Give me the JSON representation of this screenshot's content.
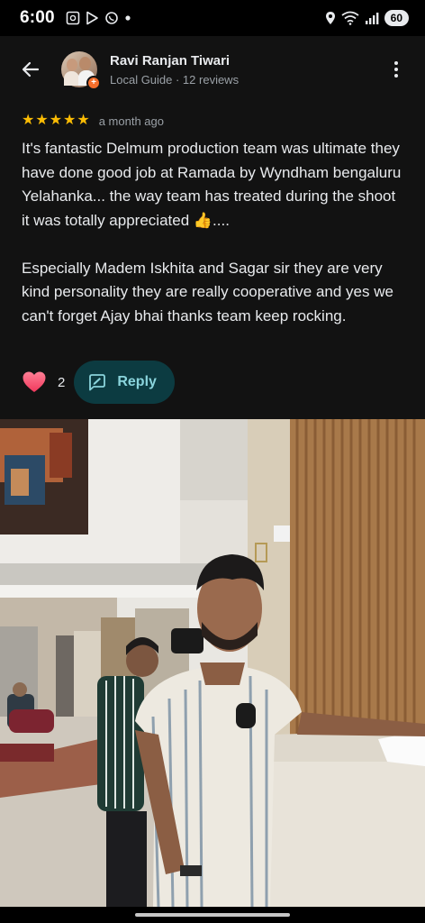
{
  "status_bar": {
    "time": "6:00",
    "battery": "60"
  },
  "header": {
    "user_name": "Ravi Ranjan Tiwari",
    "user_meta": "Local Guide · 12 reviews",
    "guide_badge": "+"
  },
  "review": {
    "rating": 5,
    "date": "a month ago",
    "text": "It's fantastic Delmum production team was ultimate they have done good job at Ramada by Wyndham bengaluru Yelahanka... the way team has treated during the shoot it was totally appreciated 👍....\n\nEspecially Madem Iskhita and Sagar sir they are very kind personality they are really cooperative and yes we can't forget Ajay bhai thanks team keep rocking."
  },
  "actions": {
    "like_count": "2",
    "reply_label": "Reply"
  },
  "colors": {
    "background": "#121212",
    "star": "#fbbc04",
    "reply_bg": "#0c3b41",
    "reply_text": "#8ad4dc",
    "heart": "#ff5a7a",
    "guide_badge": "#f46e2b"
  },
  "icons": {
    "back": "arrow-left-icon",
    "more": "more-vert-icon",
    "like": "heart-icon",
    "reply": "reply-edit-icon"
  }
}
